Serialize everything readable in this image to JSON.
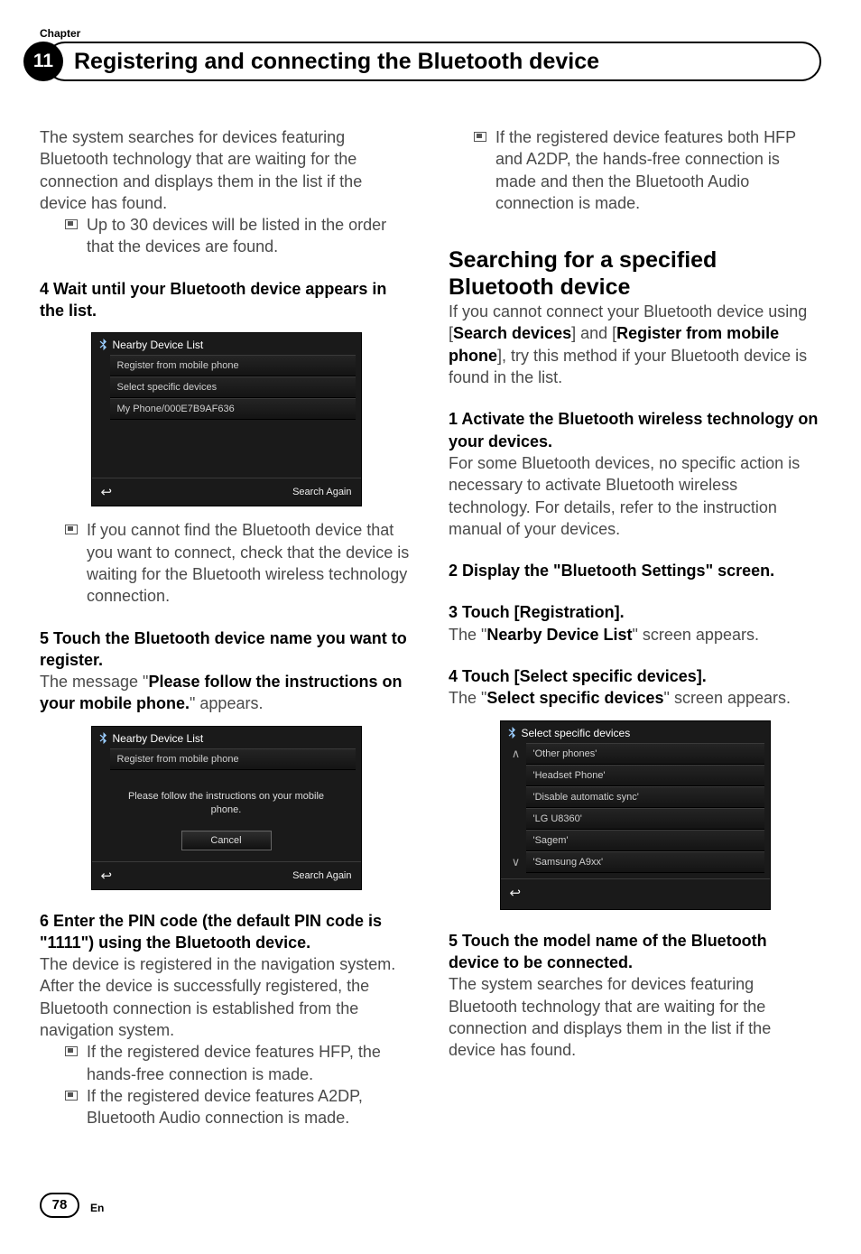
{
  "header": {
    "chapter_label": "Chapter",
    "chapter_number": "11",
    "title": "Registering and connecting the Bluetooth device"
  },
  "left": {
    "intro": "The system searches for devices featuring Bluetooth technology that are waiting for the connection and displays them in the list if the device has found.",
    "intro_bullet": "Up to 30 devices will be listed in the order that the devices are found.",
    "step4": "4    Wait until your Bluetooth device appears in the list.",
    "shot1": {
      "title": "Nearby Device List",
      "items": [
        "Register from mobile phone",
        "Select specific devices",
        "My Phone/000E7B9AF636"
      ],
      "search_again": "Search Again"
    },
    "shot1_bullet": "If you cannot find the Bluetooth device that you want to connect, check that the device is waiting for the Bluetooth wireless technology connection.",
    "step5_a": "5    Touch the Bluetooth device name you want to register.",
    "step5_b_pre": "The message \"",
    "step5_b_bold": "Please follow the instructions on your mobile phone.",
    "step5_b_post": "\" appears.",
    "shot2": {
      "title": "Nearby Device List",
      "top_item": "Register from mobile phone",
      "message": "Please follow the instructions on your mobile phone.",
      "cancel": "Cancel",
      "search_again": "Search Again"
    },
    "step6": "6    Enter the PIN code (the default PIN code is \"1111\") using the Bluetooth device.",
    "step6_after1": "The device is registered in the navigation system.",
    "step6_after2": "After the device is successfully registered, the Bluetooth connection is established from the navigation system.",
    "step6_b1": "If the registered device features HFP, the hands-free connection is made.",
    "step6_b2": "If the registered device features A2DP, Bluetooth Audio connection is made."
  },
  "right": {
    "top_bullet": "If the registered device features both HFP and A2DP, the hands-free connection is made and then the Bluetooth Audio connection is made.",
    "section_title": "Searching for a specified Bluetooth device",
    "section_intro_pre": "If you cannot connect your Bluetooth device using [",
    "section_intro_b1": "Search devices",
    "section_intro_mid": "] and [",
    "section_intro_b2": "Register from mobile phone",
    "section_intro_post": "], try this method if your Bluetooth device is found in the list.",
    "step1": "1    Activate the Bluetooth wireless technology on your devices.",
    "step1_after": "For some Bluetooth devices, no specific action is necessary to activate Bluetooth wireless technology. For details, refer to the instruction manual of your devices.",
    "step2": "2    Display the \"Bluetooth Settings\" screen.",
    "step3": "3    Touch [Registration].",
    "step3_after_pre": "The \"",
    "step3_after_b": "Nearby Device List",
    "step3_after_post": "\" screen appears.",
    "step4": "4    Touch [Select specific devices].",
    "step4_after_pre": "The \"",
    "step4_after_b": "Select specific devices",
    "step4_after_post": "\" screen appears.",
    "shot3": {
      "title": "Select specific devices",
      "items": [
        "'Other phones'",
        "'Headset Phone'",
        "'Disable automatic sync'",
        "'LG U8360'",
        "'Sagem'",
        "'Samsung A9xx'"
      ]
    },
    "step5": "5    Touch the model name of the Bluetooth device to be connected.",
    "step5_after": "The system searches for devices featuring Bluetooth technology that are waiting for the connection and displays them in the list if the device has found."
  },
  "footer": {
    "page": "78",
    "lang": "En"
  },
  "icons": {
    "back": "↩",
    "up": "∧",
    "down": "∨"
  }
}
